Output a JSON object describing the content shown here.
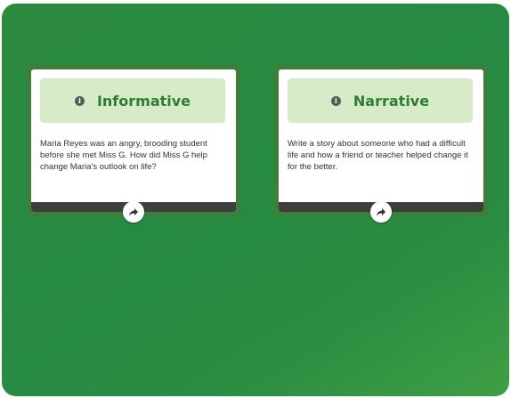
{
  "cards": [
    {
      "title": "Informative",
      "icon": "info-icon",
      "text": "Maria Reyes was an angry, brooding student before she met Miss G. How did Miss G help change Maria's outlook on life?",
      "share_icon": "share-icon"
    },
    {
      "title": "Narrative",
      "icon": "info-icon",
      "text": "Write a story about someone who had a difficult life and how a friend or teacher helped change it for the better.",
      "share_icon": "share-icon"
    }
  ],
  "colors": {
    "background": "#278a42",
    "header_fill": "#d7ebc9",
    "title_text": "#2e7d32",
    "card_border": "#3d7e3a",
    "footer_bar": "#3c3f3d"
  }
}
